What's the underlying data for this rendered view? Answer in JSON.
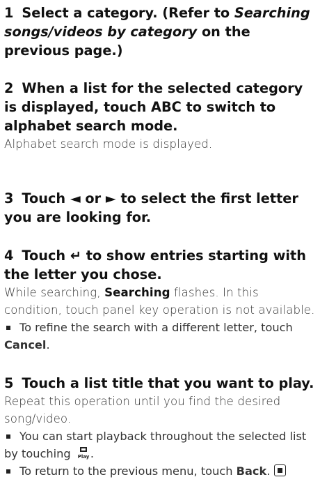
{
  "steps": [
    {
      "num": "1",
      "head_a": "Select a category. (Refer to",
      "head_italic": "Searching songs/videos by category",
      "head_b": "on the previous page.)"
    },
    {
      "num": "2",
      "head": "When a list for the selected category is displayed, touch ABC to switch to alphabet search mode.",
      "body": "Alphabet search mode is displayed."
    },
    {
      "num": "3",
      "head_a": "Touch",
      "left_arrow": "◄",
      "head_or": "or",
      "right_arrow": "►",
      "head_b": "to select the first letter you are looking for."
    },
    {
      "num": "4",
      "head_a": "Touch",
      "enter_glyph": "↵",
      "head_b": "to show entries starting with the letter you chose.",
      "body_a": "While searching,",
      "body_bold": "Searching",
      "body_b": "flashes. In this condition, touch panel key operation is not available.",
      "bullet_a": "To refine the search with a different letter, touch",
      "bullet_bold": "Cancel",
      "bullet_end": "."
    },
    {
      "num": "5",
      "head": "Touch a list title that you want to play.",
      "body": "Repeat this operation until you find the desired song/video.",
      "bullet1": "You can start playback throughout the selected list by touching",
      "bullet1_end": ".",
      "bullet2_a": "To return to the previous menu, touch",
      "bullet2_bold": "Back",
      "bullet2_end": "."
    }
  ],
  "icons": {
    "play_icon_label": "Play"
  }
}
